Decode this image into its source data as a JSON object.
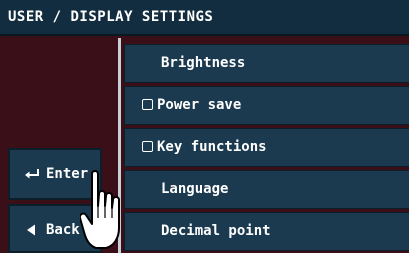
{
  "header": {
    "title": "USER / DISPLAY SETTINGS"
  },
  "menu": {
    "items": [
      {
        "label": "Brightness",
        "checkbox": false
      },
      {
        "label": "Power save",
        "checkbox": true
      },
      {
        "label": "Key functions",
        "checkbox": true
      },
      {
        "label": "Language",
        "checkbox": false
      },
      {
        "label": "Decimal point",
        "checkbox": false
      }
    ]
  },
  "buttons": {
    "enter": {
      "label": "Enter",
      "icon": "return-arrow-icon"
    },
    "back": {
      "label": "Back",
      "icon": "triangle-left-icon"
    }
  },
  "overlay": {
    "icon": "pointing-hand-cursor-icon"
  },
  "colors": {
    "background": "#3b0f18",
    "panel": "#1b3a4f",
    "title_bar": "#122d3f",
    "divider": "#c9cfd6",
    "text": "#ffffff"
  }
}
